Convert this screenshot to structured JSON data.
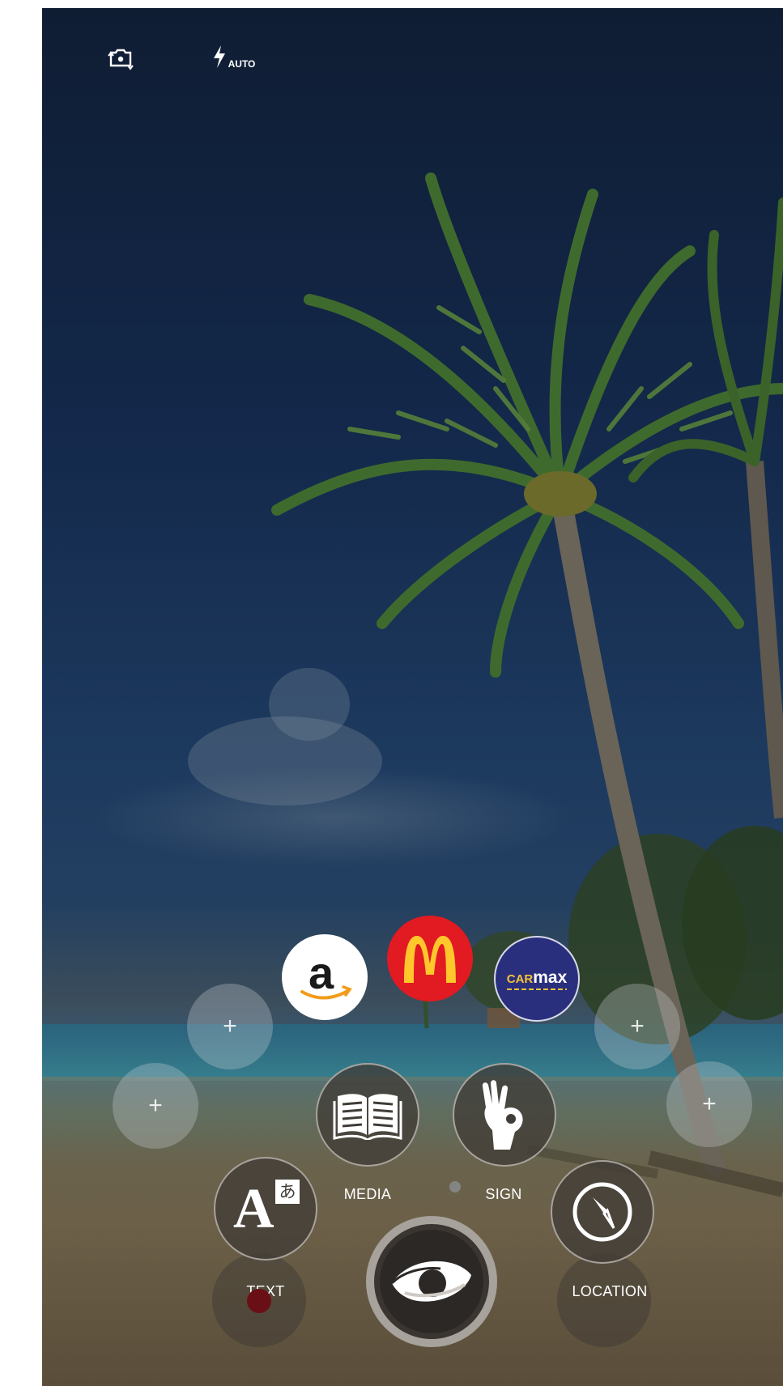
{
  "topbar": {
    "switch_camera_icon": "camera-switch-icon",
    "flash_icon": "flash-auto-icon",
    "flash_badge": "AUTO"
  },
  "brands": [
    {
      "name": "amazon",
      "glyph": "a",
      "bg": "#ffffff",
      "accent": "#f29b1c"
    },
    {
      "name": "mcdonalds",
      "glyph": "M",
      "bg": "#e21a22",
      "accent": "#ffc72c"
    },
    {
      "name": "carmax",
      "glyph_car": "CAR",
      "glyph_max": "max",
      "bg": "#2a2f7d",
      "accent": "#f4c23a"
    }
  ],
  "add_slots": {
    "symbol": "+"
  },
  "modes": {
    "media": {
      "label": "MEDIA",
      "icon": "book-icon"
    },
    "sign": {
      "label": "SIGN",
      "icon": "ok-hand-icon"
    },
    "text": {
      "label": "TEXT",
      "icon": "translate-icon",
      "glyph_main": "A",
      "glyph_sub": "あ"
    },
    "location": {
      "label": "LOCATION",
      "icon": "compass-icon"
    }
  },
  "shutter": {
    "icon": "eye-icon"
  },
  "colors": {
    "mode_bg": "#413c37",
    "shutter_ring": "#a7a29c",
    "indicator_red": "#6b0f17"
  }
}
